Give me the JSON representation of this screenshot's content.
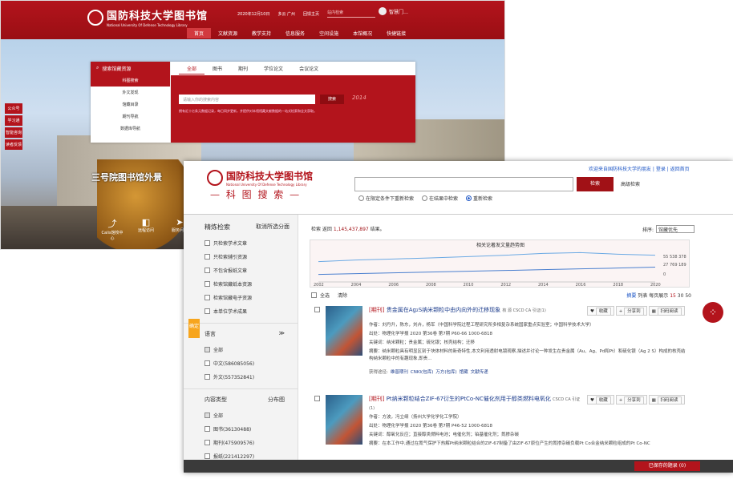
{
  "portal": {
    "logo_cn": "国防科技大学图书馆",
    "logo_en": "National University Of Defense Technology Library",
    "date": "2020年12月10日",
    "weather": "多云 广州",
    "homepage": "回馈主页",
    "search_placeholder": "站内检索",
    "user": "智慧门…",
    "nav": [
      "首页",
      "文献资源",
      "教学支持",
      "信息服务",
      "空间设施",
      "本馆概况",
      "快捷链接"
    ],
    "scene_title": "三号院图书馆外景",
    "left_tabs": [
      "公众号",
      "学习通",
      "智能咨询",
      "读者反馈"
    ],
    "quick": [
      {
        "icon": "⤴",
        "label": "Calis馆校中心"
      },
      {
        "icon": "◧",
        "label": "远程访问"
      },
      {
        "icon": "➤",
        "label": "服务问答"
      }
    ]
  },
  "search_panel": {
    "menu_title": "搜索馆藏资源",
    "menu": [
      "科图搜索",
      "外文发现",
      "馆藏目录",
      "期刊导航",
      "数据库导航"
    ],
    "tabs": [
      "全部",
      "图书",
      "期刊",
      "学位论文",
      "会议论文"
    ],
    "placeholder": "请输入你的搜索内容",
    "button": "搜索",
    "hint": "拥有近十亿条元数据记录，每日同步更新，并提供对本馆馆藏文献数据的一站式检索和全文获取。",
    "year": "2014"
  },
  "main": {
    "logo_cn": "国防科技大学图书馆",
    "logo_en": "National University Of Defense Technology Library",
    "brand": "— 科 图 搜 索 —",
    "welcome": "欢迎来自国防科技大学的朋友 | 登录 | 返回首页",
    "search_button": "检索",
    "advanced": "高级检索",
    "radios": [
      "在限定条件下重新检索",
      "在结果中检索",
      "重新检索"
    ],
    "filter_title": "精炼检索",
    "filter_cancel": "取消所选分面",
    "filters": [
      "只检索学术文章",
      "只检索辅引资源",
      "不包含报纸文章",
      "检索馆藏纸本资源",
      "检索馆藏电子资源",
      "本单位学术成果"
    ],
    "tag": "确定",
    "lang_title": "语言",
    "lang": [
      "全部",
      "中文(586085056)",
      "外文(557352841)"
    ],
    "type_title": "内容类型",
    "type_chart": "分布图",
    "types": [
      "全部",
      "图书(36130488)",
      "期刊(475909576)",
      "报纸(221412297)"
    ],
    "count_prefix": "检索 返回",
    "count": "1,145,437,897",
    "count_suffix": "结果。",
    "sort_label": "排序:",
    "sort_value": "馆藏优先",
    "trend_title": "相关论著发文量趋势图",
    "select_all": "全选",
    "clear": "清除",
    "view_abs": "摘要",
    "view_list": "列表",
    "per_page": "每页展示",
    "per_opts": [
      "15",
      "30",
      "50"
    ],
    "records": [
      {
        "type": "[期刊]",
        "title": "贵金属在Ag₂S纳米颗粒中由内向外的迁移现象",
        "badges": "核 源 CSCD CA 引证(1)",
        "author": "作者：刘丹升，陈东，刘卉，杨军（中国科学院过程工程研究所多相复杂系统国家重点实验室；中国科学技术大学）",
        "source": "出处：物理化学学报 2020 第36卷 第7期 P60-66 1000-6818",
        "keys": "关键词：纳米颗粒；贵金属；硫化银；核壳结构；迁移",
        "abs": "摘要：纳米颗粒具有明显区别于块体材料的新奇特性,本文利用透射电镜观察,描述并讨论一种发生在贵金属（Au、Ag、Pd和Pt）和硫化银（Ag 2 S）构成的核壳结构纳米颗粒中的有趣现象,即贵...",
        "get": "获得途径:",
        "links": [
          "维普期刊",
          "CNKI(包库)",
          "万方(包库)",
          "馆藏",
          "文献传递"
        ]
      },
      {
        "type": "[期刊]",
        "title": "Pt纳米颗粒结合ZIF-67衍生的PtCo-NC催化剂用于醇类燃料电氧化",
        "badges": "CSCD CA 引证(1)",
        "author": "作者：方波，冯立纲（扬州大学化学化工学院）",
        "source": "出处：物理化学学报 2020 第36卷 第7期 P46-52 1000-6818",
        "keys": "关键词：醇氧化反应；直接醇类燃料电池；电催化剂；铂基催化剂；氮掺杂碳",
        "abs": "摘要：在本工作中,通过在氮气保护下热解Pt纳米颗粒结合的ZIF-67制备了由ZIF-67原位产生的氮掺杂碳负载Pt Co合金纳米颗粒组成的Pt Co-NC"
      }
    ],
    "actions": [
      "收藏",
      "分享到",
      "扫码阅读"
    ],
    "saved": "已保存的题录 (0)"
  },
  "chart_data": {
    "type": "line",
    "title": "相关论著发文量趋势图",
    "x": [
      2002,
      2004,
      2006,
      2008,
      2010,
      2012,
      2014,
      2016,
      2018,
      2020
    ],
    "series": [
      {
        "values": [
          38000000,
          41000000,
          43000000,
          45000000,
          47500000,
          50000000,
          53500000,
          55000000,
          52000000,
          50000000
        ]
      },
      {
        "values": [
          14000000,
          15500000,
          17000000,
          18500000,
          20000000,
          21500000,
          23000000,
          24500000,
          26000000,
          27769189
        ]
      }
    ],
    "annotations": [
      "55 538 378",
      "27 769 189",
      "0"
    ],
    "colors": [
      "#6aa9e4",
      "#4a7fcf"
    ]
  }
}
